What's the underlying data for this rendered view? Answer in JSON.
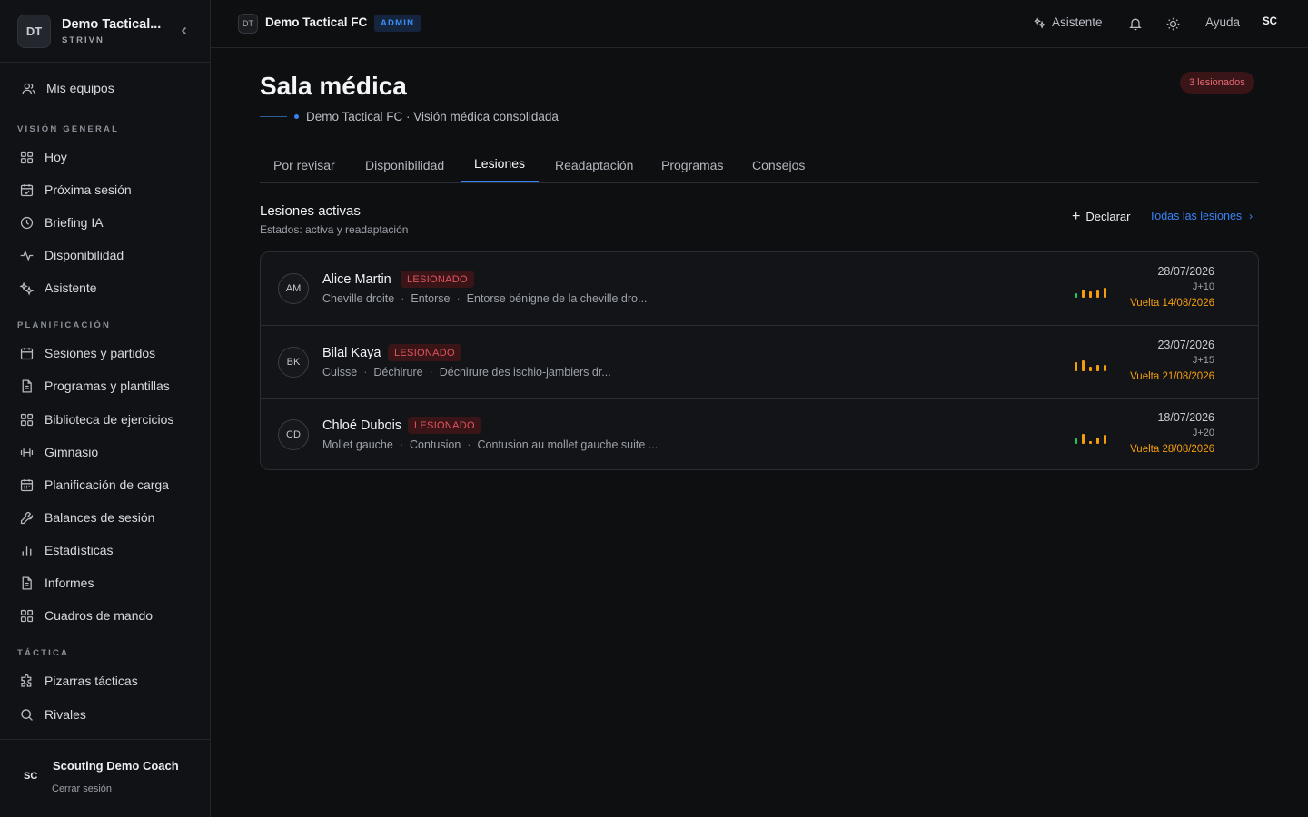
{
  "sidebar": {
    "team_initials": "DT",
    "team_name": "Demo Tactical...",
    "team_sub": "STRIVN",
    "my_teams": "Mis equipos",
    "sections": {
      "overview": "VISIÓN GENERAL",
      "planning": "PLANIFICACIÓN",
      "tactics": "TÁCTICA"
    },
    "items": {
      "today": "Hoy",
      "next_session": "Próxima sesión",
      "briefing": "Briefing IA",
      "availability": "Disponibilidad",
      "assistant": "Asistente",
      "sessions": "Sesiones y partidos",
      "programs": "Programas y plantillas",
      "library": "Biblioteca de ejercicios",
      "gym": "Gimnasio",
      "load": "Planificación de carga",
      "balances": "Balances de sesión",
      "stats": "Estadísticas",
      "reports": "Informes",
      "dashboards": "Cuadros de mando",
      "boards": "Pizarras tácticas",
      "rivals": "Rivales"
    },
    "user": {
      "initials": "SC",
      "name": "Scouting Demo Coach",
      "logout": "Cerrar sesión"
    }
  },
  "topbar": {
    "team_initials": "DT",
    "team_name": "Demo Tactical FC",
    "role": "ADMIN",
    "assistant": "Asistente",
    "help": "Ayuda",
    "user_initials": "SC"
  },
  "page": {
    "title": "Sala médica",
    "subtitle": "Demo Tactical FC · Visión médica consolidada",
    "injured_count": "3 lesionados"
  },
  "tabs": [
    "Por revisar",
    "Disponibilidad",
    "Lesiones",
    "Readaptación",
    "Programas",
    "Consejos"
  ],
  "active_tab": "Lesiones",
  "section": {
    "title": "Lesiones activas",
    "subtitle": "Estados: activa y readaptación",
    "declare": "Declarar",
    "all_link": "Todas las lesiones"
  },
  "colors": {
    "accent": "#3b82f6",
    "danger": "#e0545d",
    "warning": "#f59e0b",
    "success": "#22c55e"
  },
  "injuries": [
    {
      "initials": "AM",
      "name": "Alice Martin",
      "status": "LESIONADO",
      "location": "Cheville droite",
      "type": "Entorse",
      "description": "Entorse bénigne de la cheville dro...",
      "date": "28/07/2026",
      "day": "J+10",
      "return": "Vuelta 14/08/2026",
      "trend": [
        {
          "level": 0.45,
          "color": "#22c55e"
        },
        {
          "level": 0.75,
          "color": "#f59e0b"
        },
        {
          "level": 0.6,
          "color": "#f59e0b"
        },
        {
          "level": 0.65,
          "color": "#f59e0b"
        },
        {
          "level": 0.9,
          "color": "#f59e0b"
        }
      ]
    },
    {
      "initials": "BK",
      "name": "Bilal Kaya",
      "status": "LESIONADO",
      "location": "Cuisse",
      "type": "Déchirure",
      "description": "Déchirure des ischio-jambiers dr...",
      "date": "23/07/2026",
      "day": "J+15",
      "return": "Vuelta 21/08/2026",
      "trend": [
        {
          "level": 0.85,
          "color": "#f59e0b"
        },
        {
          "level": 1.0,
          "color": "#f59e0b"
        },
        {
          "level": 0.4,
          "color": "#f59e0b"
        },
        {
          "level": 0.55,
          "color": "#f59e0b"
        },
        {
          "level": 0.55,
          "color": "#f59e0b"
        }
      ]
    },
    {
      "initials": "CD",
      "name": "Chloé Dubois",
      "status": "LESIONADO",
      "location": "Mollet gauche",
      "type": "Contusion",
      "description": "Contusion au mollet gauche suite ...",
      "date": "18/07/2026",
      "day": "J+20",
      "return": "Vuelta 28/08/2026",
      "trend": [
        {
          "level": 0.5,
          "color": "#22c55e"
        },
        {
          "level": 0.9,
          "color": "#f59e0b"
        },
        {
          "level": 0.25,
          "color": "#f59e0b"
        },
        {
          "level": 0.6,
          "color": "#f59e0b"
        },
        {
          "level": 0.85,
          "color": "#f59e0b"
        }
      ]
    }
  ]
}
